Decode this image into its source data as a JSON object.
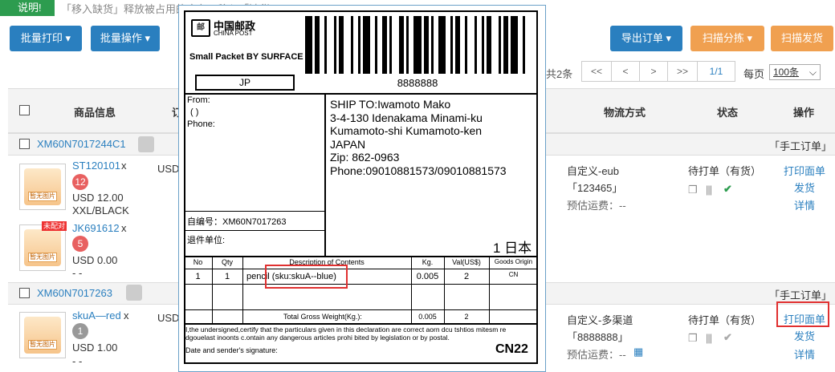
{
  "hint": {
    "badge": "说明!",
    "text": "「移入缺货」释放被占用的库存，移入「缺货」"
  },
  "toolbar": {
    "batch_print": "批量打印 ▾",
    "batch_ops": "批量操作 ▾",
    "export_orders": "导出订单 ▾",
    "scan_sort": "扫描分拣 ▾",
    "scan_ship": "扫描发货"
  },
  "pagination": {
    "total": "共2条",
    "first": "<<",
    "prev": "<",
    "next": ">",
    "last": ">>",
    "page": "1/1",
    "per_page_label": "每页",
    "per_page_value": "100条"
  },
  "table": {
    "headers": {
      "product": "商品信息",
      "col2": "订",
      "shipping": "物流方式",
      "status": "状态",
      "ops": "操作"
    }
  },
  "orders": [
    {
      "order_no": "XM60N7017244C1",
      "tag": "「手工订单」",
      "items": [
        {
          "sku": "ST120101",
          "mult": "x",
          "qty": "12",
          "price": "USD 12.00",
          "variant": "XXL/BLACK",
          "thumb_label": "暂无图片"
        },
        {
          "sku": "JK691612",
          "mult": "x",
          "qty": "5",
          "price": "USD 0.00",
          "variant": "- -",
          "thumb_label": "暂无图片",
          "unmatched": "未配对"
        }
      ],
      "currency": "USD",
      "shipping": {
        "method": "自定义-eub",
        "tracking": "「123465」",
        "fee": "预估运费：--"
      },
      "status": "待打单（有货）",
      "actions": {
        "print": "打印面单",
        "ship": "发货",
        "detail": "详情"
      }
    },
    {
      "order_no": "XM60N7017263",
      "tag": "「手工订单」",
      "items": [
        {
          "sku": "skuA—red",
          "mult": "x",
          "qty": "1",
          "price": "USD 1.00",
          "variant": "- -",
          "thumb_label": "暂无图片"
        }
      ],
      "currency": "USD",
      "shipping": {
        "method": "自定义-多渠道",
        "tracking": "「8888888」",
        "fee": "预估运费：--"
      },
      "status": "待打单（有货）",
      "actions": {
        "print": "打印面单",
        "ship": "发货",
        "detail": "详情"
      }
    }
  ],
  "label": {
    "logo_cn": "中国邮政",
    "logo_en": "CHINA POST",
    "service": "Small Packet BY SURFACE",
    "country_code": "JP",
    "barcode_no": "8888888",
    "from": "From:",
    "from_paren": "(  )",
    "phone": "Phone:",
    "ship_to": [
      "SHIP TO:Iwamoto Mako",
      "3-4-130 Idenakama Minami-ku",
      "Kumamoto-shi Kumamoto-ken",
      "JAPAN",
      "Zip: 862-0963",
      "Phone:09010881573/09010881573"
    ],
    "self_no": "自编号：XM60N7017263",
    "return_unit": "退件单位:",
    "country_cn": "1 日本",
    "decl_headers": [
      "No",
      "Qty",
      "Description of Contents",
      "Kg.",
      "Val(US$)",
      "Goods Origin"
    ],
    "decl_row": [
      "1",
      "1",
      "pencil (sku:skuA--blue)",
      "0.005",
      "2",
      "CN"
    ],
    "total_label": "Total Gross Weight(Kg.):",
    "total_kg": "0.005",
    "total_val": "2",
    "certify": "I,the undersigned,certify that the particulars given in this declaration are correct aorn dcu tshtios mitesm re dgouelast inoonts c.ontain any dangerous articles prohi bited by legislation or by postal.",
    "signature": "Date and sender's signature:",
    "form": "CN22"
  },
  "colors": {
    "blue": "#2a7fbf",
    "orange": "#f0a050",
    "green": "#2d9c4f",
    "highlight": "#e03030"
  }
}
